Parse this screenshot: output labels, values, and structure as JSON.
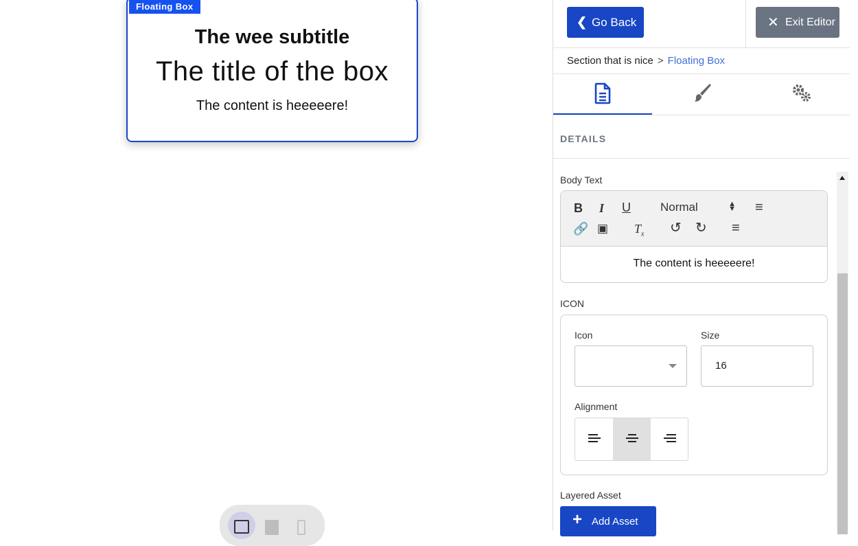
{
  "canvas": {
    "box": {
      "tag": "Floating Box",
      "subtitle": "The wee subtitle",
      "title": "The title of the box",
      "content": "The content is heeeeere!"
    },
    "device_toggle": {
      "items": [
        "desktop-icon",
        "tablet-icon",
        "mobile-icon"
      ],
      "selected": "desktop"
    }
  },
  "editor": {
    "header": {
      "back_label": "Go Back",
      "exit_label": "Exit Editor"
    },
    "breadcrumb": {
      "parent": "Section that is nice",
      "separator": ">",
      "current": "Floating Box"
    },
    "tabs": [
      {
        "icon": "document-icon",
        "active": true
      },
      {
        "icon": "brush-icon",
        "active": false
      },
      {
        "icon": "gears-icon",
        "active": false
      }
    ],
    "section_title": "DETAILS",
    "body_text": {
      "label": "Body Text",
      "format_select": "Normal",
      "content": "The content is heeeeere!"
    },
    "icon_section": {
      "label": "ICON",
      "icon_field_label": "Icon",
      "icon_value": "",
      "size_field_label": "Size",
      "size_value": "16",
      "alignment_label": "Alignment",
      "alignment_selected": "center"
    },
    "layered_asset": {
      "label": "Layered Asset",
      "button_label": "Add Asset"
    }
  },
  "colors": {
    "primary": "#1846c4",
    "box_tag": "#1652f0",
    "secondary_button": "#6a7382",
    "link": "#3f6fd8"
  }
}
